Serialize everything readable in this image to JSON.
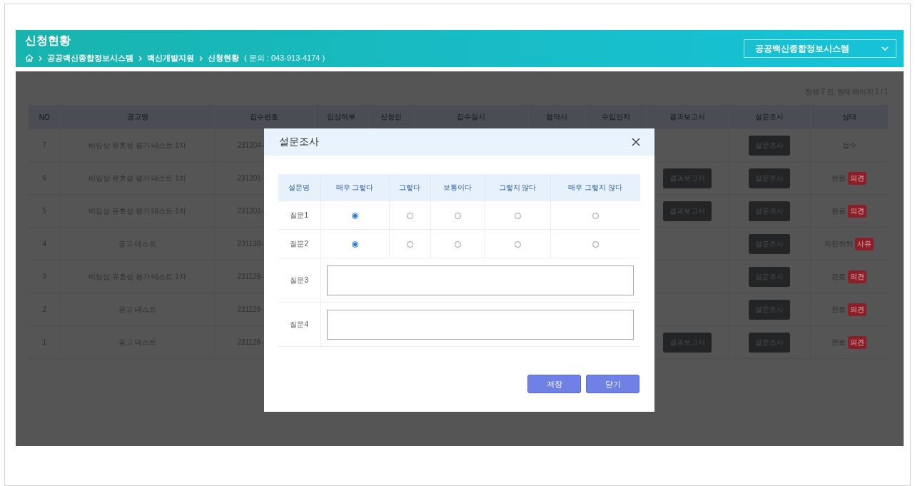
{
  "header": {
    "title": "신청현황",
    "breadcrumb": [
      "공공백신종합정보시스템",
      "백신개발지원",
      "신청현황"
    ],
    "contact": "( 문의 : 043-913-4174 )",
    "system_select": {
      "value": "공공백신종합정보시스템"
    }
  },
  "listing": {
    "summary": "전체 7 건, 현재 페이지 1 / 1",
    "columns": [
      "NO",
      "공고명",
      "접수번호",
      "임상여부",
      "신청인",
      "접수일시",
      "협약서",
      "수입인지",
      "결과보고서",
      "설문조사",
      "상태"
    ],
    "rows": [
      {
        "no": "7",
        "title": "비임상 유효성 평가 테스트 1차",
        "receipt_no": "231204-",
        "survey_button": "설문조사",
        "status": "접수"
      },
      {
        "no": "6",
        "title": "비임상 유효성 평가 테스트 1차",
        "receipt_no": "231201-",
        "report_button": "결과보고서",
        "survey_button": "설문조사",
        "status": "완료",
        "status_badge": "의견"
      },
      {
        "no": "5",
        "title": "비임상 유효성 평가 테스트 1차",
        "receipt_no": "231201-",
        "report_button": "결과보고서",
        "survey_button": "설문조사",
        "status": "완료",
        "status_badge": "의견"
      },
      {
        "no": "4",
        "title": "공고 테스트",
        "receipt_no": "231130-",
        "survey_button": "설문조사",
        "status": "자진취하",
        "status_badge": "사유"
      },
      {
        "no": "3",
        "title": "비임상 유효성 평가 테스트 1차",
        "receipt_no": "231129-",
        "survey_button": "설문조사",
        "status": "완료",
        "status_badge": "의견"
      },
      {
        "no": "2",
        "title": "공고 테스트",
        "receipt_no": "231129-",
        "survey_button": "설문조사",
        "status": "완료",
        "status_badge": "의견"
      },
      {
        "no": "1",
        "title": "공고 테스트",
        "receipt_no": "231128-",
        "report_button": "결과보고서",
        "survey_button": "설문조사",
        "status": "완료",
        "status_badge": "의견"
      }
    ]
  },
  "modal": {
    "title": "설문조사",
    "columns": [
      "설문명",
      "매우 그렇다",
      "그렇다",
      "보통이다",
      "그렇지 않다",
      "매우 그렇지 않다"
    ],
    "questions": [
      {
        "label": "질문1",
        "kind": "choice",
        "choices": [
          {
            "selected": true
          },
          {
            "selected": false
          },
          {
            "selected": false
          },
          {
            "selected": false
          },
          {
            "selected": false
          }
        ]
      },
      {
        "label": "질문2",
        "kind": "choice",
        "choices": [
          {
            "selected": true
          },
          {
            "selected": false
          },
          {
            "selected": false
          },
          {
            "selected": false
          },
          {
            "selected": false
          }
        ]
      },
      {
        "label": "질문3",
        "kind": "text"
      },
      {
        "label": "질문4",
        "kind": "text"
      }
    ],
    "buttons": [
      "저장",
      "닫기"
    ]
  }
}
